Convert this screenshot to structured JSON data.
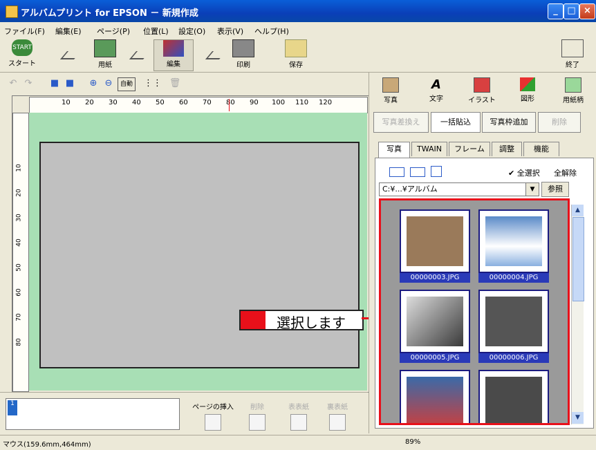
{
  "window": {
    "title": "アルバムプリント for EPSON － 新規作成",
    "minimize": "_",
    "maximize": "□",
    "close": "×"
  },
  "menu": [
    "ファイル(F)",
    "編集(E)",
    "ページ(P)",
    "位置(L)",
    "設定(O)",
    "表示(V)",
    "ヘルプ(H)"
  ],
  "toolbar": {
    "start_badge": "START",
    "start": "スタート",
    "paper": "用紙",
    "edit": "編集",
    "print": "印刷",
    "save": "保存",
    "quit": "終了"
  },
  "subtoolbar": {
    "fit": "自動"
  },
  "ruler": {
    "h": [
      "10",
      "20",
      "30",
      "40",
      "50",
      "60",
      "70",
      "80",
      "90",
      "100",
      "110",
      "120"
    ],
    "v": [
      "10",
      "20",
      "30",
      "40",
      "50",
      "60",
      "70",
      "80"
    ]
  },
  "callout": {
    "text": "選択します"
  },
  "page_panel": {
    "page_number": "1",
    "insert_page": "ページの挿入",
    "delete": "削除",
    "front": "表表紙",
    "back": "裏表紙"
  },
  "status": {
    "mouse": "マウス(159.6mm,464mm)",
    "zoom": "89%"
  },
  "categories": [
    "写真",
    "文字",
    "イラスト",
    "図形",
    "用紙柄"
  ],
  "actions": {
    "replace": "写真差換え",
    "batch": "一括貼込",
    "add_frame": "写真枠追加",
    "delete": "削除"
  },
  "tabs": [
    "写真",
    "TWAIN",
    "フレーム",
    "調整",
    "機能"
  ],
  "view": {
    "select_all": "✔ 全選択",
    "deselect_all": "全解除"
  },
  "path": {
    "value": "C:¥...¥アルバム",
    "browse": "参照"
  },
  "thumbnails": [
    {
      "name": "00000003.JPG",
      "color": "#9a7a5a"
    },
    {
      "name": "00000004.JPG",
      "color": "#5a8ac8"
    },
    {
      "name": "00000005.JPG",
      "color": "#3a3a3a"
    },
    {
      "name": "00000006.JPG",
      "color": "#555555"
    },
    {
      "name": "",
      "color": "#3a6aa8"
    },
    {
      "name": "",
      "color": "#4a4a4a"
    }
  ],
  "colors": {
    "accent_red": "#e8101a",
    "title_blue": "#0a3fb8",
    "canvas_green": "#a8dfb5"
  }
}
